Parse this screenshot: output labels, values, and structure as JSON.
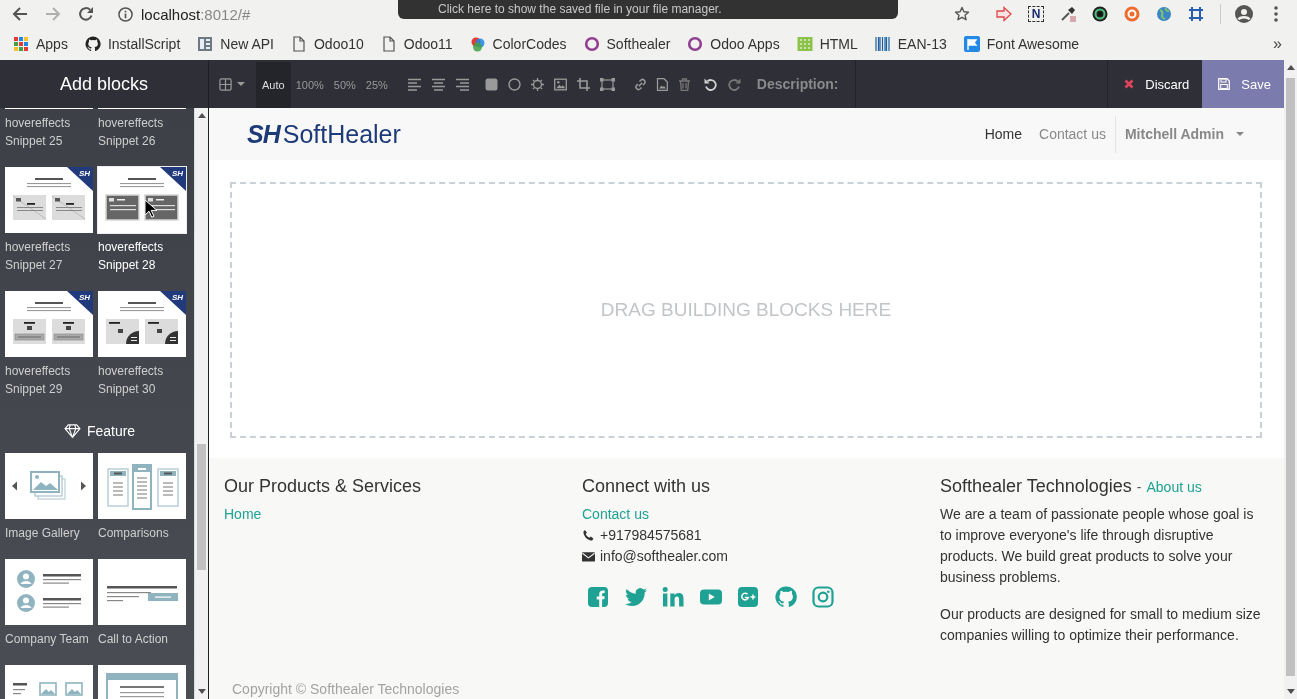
{
  "browser": {
    "nav": [
      {
        "kind": "back",
        "disabled": false
      },
      {
        "kind": "forward",
        "disabled": true
      },
      {
        "kind": "reload",
        "disabled": false
      }
    ],
    "address": {
      "host": "localhost",
      "path": ":8012/#"
    },
    "notice": "Click here to show the saved file in your file manager.",
    "extensions": [
      {
        "kind": "arrow"
      },
      {
        "kind": "letter",
        "text": "N"
      },
      {
        "kind": "picker"
      },
      {
        "kind": "lens"
      },
      {
        "kind": "lifebuoy"
      },
      {
        "kind": "globe"
      },
      {
        "kind": "frame"
      }
    ],
    "bookmarks": [
      {
        "kind": "apps",
        "label": "Apps"
      },
      {
        "kind": "github",
        "label": "InstallScript"
      },
      {
        "kind": "book",
        "label": "New API"
      },
      {
        "kind": "page",
        "label": "Odoo10"
      },
      {
        "kind": "page",
        "label": "Odoo11"
      },
      {
        "kind": "colors",
        "label": "ColorCodes"
      },
      {
        "kind": "ring",
        "label": "Softhealer"
      },
      {
        "kind": "ring",
        "label": "Odoo Apps"
      },
      {
        "kind": "sheet",
        "label": "HTML"
      },
      {
        "kind": "barcode",
        "label": "EAN-13"
      },
      {
        "kind": "flag",
        "label": "Font Awesome"
      }
    ],
    "more": "»"
  },
  "sidebar": {
    "title": "Add blocks",
    "sections": [
      {
        "blocks": [
          {
            "kind": "cut",
            "label": "hovereffects Snippet 25",
            "hovered": false
          },
          {
            "kind": "cut",
            "label": "hovereffects Snippet 26",
            "hovered": false
          },
          {
            "kind": "hover-split",
            "badge": "SH",
            "label": "hovereffects Snippet 27",
            "hovered": false
          },
          {
            "kind": "hover-dark",
            "badge": "SH",
            "label": "hovereffects Snippet 28",
            "hovered": true
          },
          {
            "kind": "hover-caption",
            "badge": "SH",
            "label": "hovereffects Snippet 29",
            "hovered": false
          },
          {
            "kind": "hover-corner",
            "badge": "SH",
            "label": "hovereffects Snippet 30",
            "hovered": false
          }
        ]
      },
      {
        "heading": "Feature",
        "blocks": [
          {
            "kind": "gallery",
            "label": "Image Gallery",
            "hovered": false
          },
          {
            "kind": "comparisons",
            "label": "Comparisons",
            "hovered": false
          },
          {
            "kind": "team",
            "label": "Company Team",
            "hovered": false
          },
          {
            "kind": "cta",
            "label": "Call to Action",
            "hovered": false
          },
          {
            "kind": "features",
            "hovered": false
          },
          {
            "kind": "banner",
            "hovered": false
          }
        ]
      }
    ]
  },
  "toolbar": {
    "sizes": [
      {
        "label": "Auto",
        "selected": true
      },
      {
        "label": "100%",
        "selected": false
      },
      {
        "label": "50%",
        "selected": false
      },
      {
        "label": "25%",
        "selected": false
      }
    ],
    "history": [
      {
        "kind": "undo",
        "disabled": false
      },
      {
        "kind": "redo",
        "disabled": true
      }
    ],
    "description_label": "Description:",
    "discard": "Discard",
    "save": "Save"
  },
  "site": {
    "brand": {
      "mark": "SH",
      "name": "SoftHealer"
    },
    "menu": [
      {
        "label": "Home",
        "selected": true
      },
      {
        "label": "Contact us",
        "selected": false
      }
    ],
    "user": "Mitchell Admin",
    "dropzone": "DRAG BUILDING BLOCKS HERE"
  },
  "footer": {
    "columns": [
      {
        "kind": "links",
        "heading": "Our Products & Services",
        "links": [
          "Home"
        ]
      },
      {
        "kind": "contact",
        "heading": "Connect with us",
        "links": [
          "Contact us"
        ],
        "contacts": [
          {
            "kind": "phone",
            "text": "+917984575681"
          },
          {
            "kind": "email",
            "text": "info@softhealer.com"
          }
        ],
        "social": [
          {
            "kind": "facebook"
          },
          {
            "kind": "twitter"
          },
          {
            "kind": "linkedin"
          },
          {
            "kind": "youtube"
          },
          {
            "kind": "googleplus"
          },
          {
            "kind": "github"
          },
          {
            "kind": "instagram"
          }
        ]
      },
      {
        "kind": "about",
        "heading": "Softhealer Technologies",
        "separator": "-",
        "link": "About us",
        "paragraphs": [
          "We are a team of passionate people whose goal is to improve everyone's life through disruptive products. We build great products to solve your business problems.",
          "Our products are designed for small to medium size companies willing to optimize their performance."
        ]
      }
    ],
    "copyright": "Copyright © Softhealer Technologies"
  }
}
